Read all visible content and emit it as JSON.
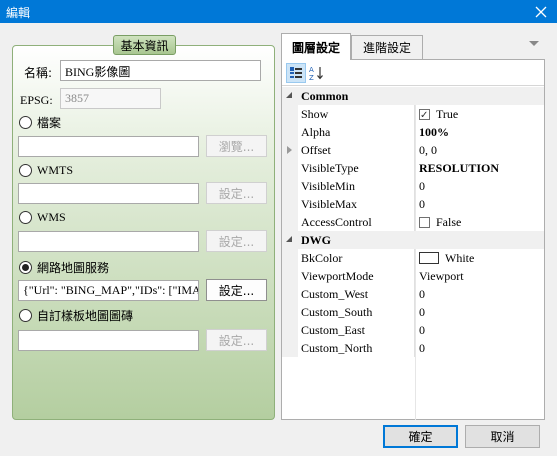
{
  "window": {
    "title": "編輯"
  },
  "group": {
    "title": "基本資訊",
    "name_label": "名稱:",
    "name_value": "BING影像圖",
    "epsg_label": "EPSG:",
    "epsg_value": "3857",
    "sources": [
      {
        "label": "檔案",
        "button": "瀏覽...",
        "value": "",
        "checked": false,
        "enabled": false
      },
      {
        "label": "WMTS",
        "button": "設定...",
        "value": "",
        "checked": false,
        "enabled": false
      },
      {
        "label": "WMS",
        "button": "設定...",
        "value": "",
        "checked": false,
        "enabled": false
      },
      {
        "label": "網路地圖服務",
        "button": "設定...",
        "value": "{\"Url\": \"BING_MAP\",\"IDs\": [\"IMAG",
        "checked": true,
        "enabled": true
      },
      {
        "label": "自訂樣板地圖圖磚",
        "button": "設定...",
        "value": "",
        "checked": false,
        "enabled": false
      }
    ]
  },
  "tabs": {
    "active": "圖層設定",
    "other": "進階設定"
  },
  "property_grid": {
    "categories": [
      {
        "name": "Common",
        "rows": [
          {
            "name": "Show",
            "value": "True",
            "checkbox": true,
            "checked": true
          },
          {
            "name": "Alpha",
            "value": "100%",
            "bold": true
          },
          {
            "name": "Offset",
            "value": "0, 0",
            "expandable": true
          },
          {
            "name": "VisibleType",
            "value": "RESOLUTION",
            "bold": true
          },
          {
            "name": "VisibleMin",
            "value": "0"
          },
          {
            "name": "VisibleMax",
            "value": "0"
          },
          {
            "name": "AccessControl",
            "value": "False",
            "checkbox": true,
            "checked": false
          }
        ]
      },
      {
        "name": "DWG",
        "rows": [
          {
            "name": "BkColor",
            "value": "White",
            "swatch": "#ffffff"
          },
          {
            "name": "ViewportMode",
            "value": "Viewport"
          },
          {
            "name": "Custom_West",
            "value": "0"
          },
          {
            "name": "Custom_South",
            "value": "0"
          },
          {
            "name": "Custom_East",
            "value": "0"
          },
          {
            "name": "Custom_North",
            "value": "0"
          }
        ]
      }
    ]
  },
  "footer": {
    "ok": "確定",
    "cancel": "取消"
  },
  "colors": {
    "titlebar": "#0078d7",
    "group_gradient_end": "#b4cea0"
  }
}
